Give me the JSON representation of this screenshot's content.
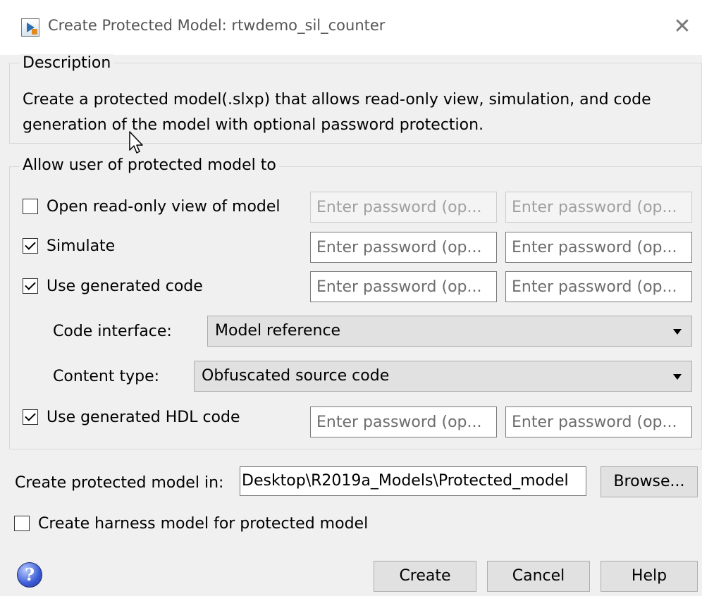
{
  "window": {
    "title": "Create Protected Model: rtwdemo_sil_counter",
    "close_glyph": "✕"
  },
  "description": {
    "legend": "Description",
    "text": "Create a protected model(.slxp) that allows read-only view, simulation, and code generation of the model with optional password protection."
  },
  "allow": {
    "legend": "Allow user of protected model to",
    "options": [
      {
        "label": "Open read-only view of model",
        "checked": false,
        "enabled": false
      },
      {
        "label": "Simulate",
        "checked": true,
        "enabled": true
      },
      {
        "label": "Use generated code",
        "checked": true,
        "enabled": true
      },
      {
        "label": "Use generated HDL code",
        "checked": true,
        "enabled": true
      }
    ],
    "password_placeholder": "Enter password (op...",
    "code_interface": {
      "label": "Code interface:",
      "value": "Model reference"
    },
    "content_type": {
      "label": "Content type:",
      "value": "Obfuscated source code"
    }
  },
  "location": {
    "label": "Create protected model in:",
    "value": "Desktop\\R2019a_Models\\Protected_model",
    "browse_label": "Browse..."
  },
  "harness": {
    "label": "Create harness model for protected model",
    "checked": false
  },
  "footer": {
    "help_glyph": "?",
    "create_label": "Create",
    "cancel_label": "Cancel",
    "help_label": "Help"
  }
}
